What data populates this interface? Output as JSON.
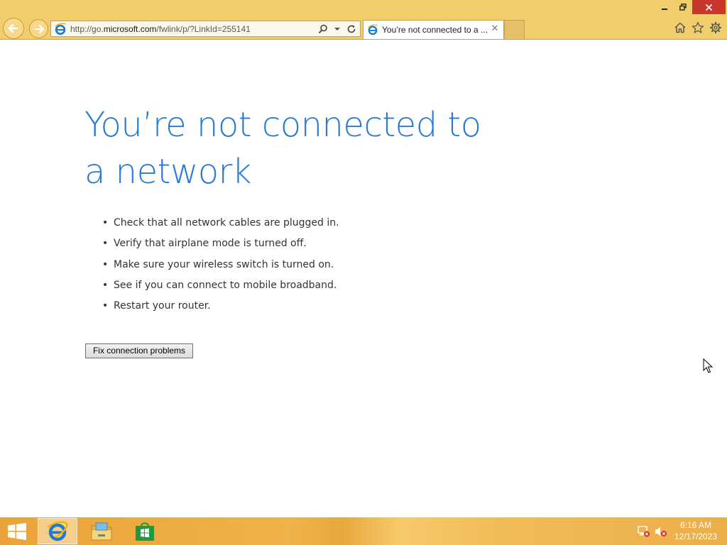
{
  "browser": {
    "url_prefix": "http://go.",
    "url_domain": "microsoft.com",
    "url_path": "/fwlink/p/?LinkId=255141",
    "tab_title": "You’re not connected to a ...",
    "tab_close": "✕"
  },
  "page": {
    "heading": "You’re not connected to a network",
    "tips": [
      "Check that all network cables are plugged in.",
      "Verify that airplane mode is turned off.",
      "Make sure your wireless switch is turned on.",
      "See if you can connect to mobile broadband.",
      "Restart your router."
    ],
    "bullet": "•",
    "fix_button": "Fix connection problems"
  },
  "taskbar": {
    "time": "6:16 AM",
    "date": "12/17/2023"
  },
  "colors": {
    "chrome": "#f1cd6b",
    "heading": "#2a7ad3",
    "taskbar": "#ecae49",
    "close": "#c7372b"
  },
  "icons": [
    "back-icon",
    "forward-icon",
    "ie-icon",
    "search-icon",
    "dropdown-icon",
    "refresh-icon",
    "close-icon",
    "minimize-icon",
    "restore-icon",
    "home-icon",
    "favorites-icon",
    "gear-icon",
    "windows-start-icon",
    "file-explorer-icon",
    "store-icon",
    "network-icon",
    "volume-muted-icon",
    "cursor-icon"
  ]
}
